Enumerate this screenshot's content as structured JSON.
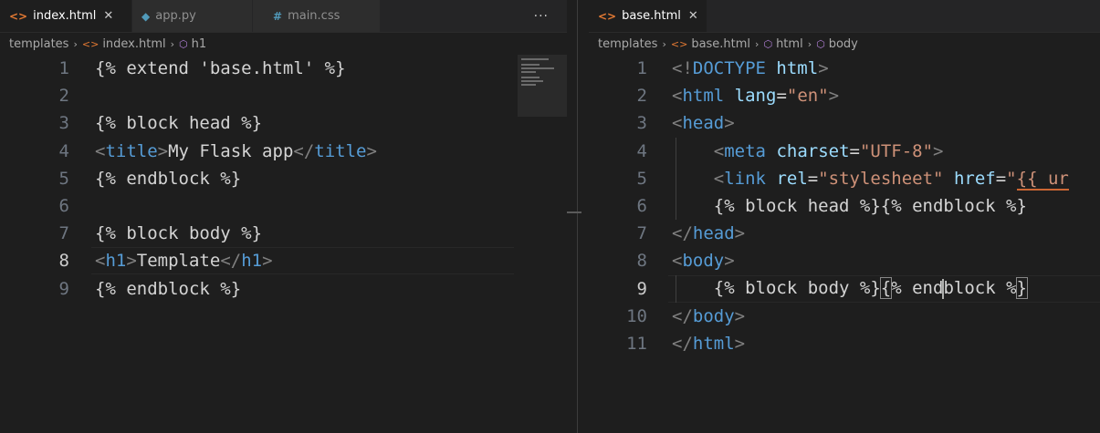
{
  "left": {
    "tabs": [
      {
        "name": "index.html",
        "icon": "html-icon",
        "active": true
      },
      {
        "name": "app.py",
        "icon": "python-icon",
        "active": false
      },
      {
        "name": "main.css",
        "icon": "css-icon",
        "active": false
      }
    ],
    "more_label": "···",
    "breadcrumb": {
      "folder": "templates",
      "file": "index.html",
      "symbol": "h1"
    },
    "lines": [
      {
        "n": "1",
        "text": "{% extend 'base.html' %}"
      },
      {
        "n": "2",
        "text": ""
      },
      {
        "n": "3",
        "text": "{% block head %}"
      },
      {
        "n": "4",
        "parts": [
          [
            "<",
            "punc"
          ],
          [
            "title",
            "tag"
          ],
          [
            ">",
            "punc"
          ],
          [
            "My Flask app",
            "text"
          ],
          [
            "</",
            "punc"
          ],
          [
            "title",
            "tag"
          ],
          [
            ">",
            "punc"
          ]
        ]
      },
      {
        "n": "5",
        "text": "{% endblock %}"
      },
      {
        "n": "6",
        "text": ""
      },
      {
        "n": "7",
        "text": "{% block body %}"
      },
      {
        "n": "8",
        "parts": [
          [
            "<",
            "punc"
          ],
          [
            "h1",
            "tag"
          ],
          [
            ">",
            "punc"
          ],
          [
            "Template",
            "text"
          ],
          [
            "</",
            "punc"
          ],
          [
            "h1",
            "tag"
          ],
          [
            ">",
            "punc"
          ]
        ]
      },
      {
        "n": "9",
        "text": "{% endblock %}"
      }
    ]
  },
  "right": {
    "tab": {
      "name": "base.html",
      "icon": "html-icon"
    },
    "breadcrumb": {
      "folder": "templates",
      "file": "base.html",
      "symbol1": "html",
      "symbol2": "body"
    },
    "lines": [
      {
        "n": "1",
        "parts": [
          [
            "<!",
            "punc"
          ],
          [
            "DOCTYPE",
            "tag"
          ],
          [
            " ",
            "text"
          ],
          [
            "html",
            "attr"
          ],
          [
            ">",
            "punc"
          ]
        ]
      },
      {
        "n": "2",
        "parts": [
          [
            "<",
            "punc"
          ],
          [
            "html",
            "tag"
          ],
          [
            " ",
            "text"
          ],
          [
            "lang",
            "attr"
          ],
          [
            "=",
            "text"
          ],
          [
            "\"en\"",
            "str"
          ],
          [
            ">",
            "punc"
          ]
        ]
      },
      {
        "n": "3",
        "parts": [
          [
            "<",
            "punc"
          ],
          [
            "head",
            "tag"
          ],
          [
            ">",
            "punc"
          ]
        ]
      },
      {
        "n": "4",
        "parts": [
          [
            "    ",
            "text"
          ],
          [
            "<",
            "punc"
          ],
          [
            "meta",
            "tag"
          ],
          [
            " ",
            "text"
          ],
          [
            "charset",
            "attr"
          ],
          [
            "=",
            "text"
          ],
          [
            "\"UTF-8\"",
            "str"
          ],
          [
            ">",
            "punc"
          ]
        ]
      },
      {
        "n": "5",
        "parts": [
          [
            "    ",
            "text"
          ],
          [
            "<",
            "punc"
          ],
          [
            "link",
            "tag"
          ],
          [
            " ",
            "text"
          ],
          [
            "rel",
            "attr"
          ],
          [
            "=",
            "text"
          ],
          [
            "\"stylesheet\"",
            "str"
          ],
          [
            " ",
            "text"
          ],
          [
            "href",
            "attr"
          ],
          [
            "=",
            "text"
          ],
          [
            "\"",
            "str"
          ],
          [
            "{{ ur",
            "warn"
          ]
        ]
      },
      {
        "n": "6",
        "parts": [
          [
            "    ",
            "text"
          ],
          [
            "{% block head %}{% endblock %}",
            "text"
          ]
        ]
      },
      {
        "n": "7",
        "parts": [
          [
            "</",
            "punc"
          ],
          [
            "head",
            "tag"
          ],
          [
            ">",
            "punc"
          ]
        ]
      },
      {
        "n": "8",
        "parts": [
          [
            "<",
            "punc"
          ],
          [
            "body",
            "tag"
          ],
          [
            ">",
            "punc"
          ]
        ]
      },
      {
        "n": "9",
        "parts": [
          [
            "    {% block body %}",
            "text"
          ],
          [
            "{",
            "box"
          ],
          [
            "% end",
            "text"
          ],
          [
            "",
            "caret"
          ],
          [
            "block %",
            "text"
          ],
          [
            "}",
            "box"
          ]
        ]
      },
      {
        "n": "10",
        "parts": [
          [
            "</",
            "punc"
          ],
          [
            "body",
            "tag"
          ],
          [
            ">",
            "punc"
          ]
        ]
      },
      {
        "n": "11",
        "parts": [
          [
            "</",
            "punc"
          ],
          [
            "html",
            "tag"
          ],
          [
            ">",
            "punc"
          ]
        ]
      }
    ]
  }
}
